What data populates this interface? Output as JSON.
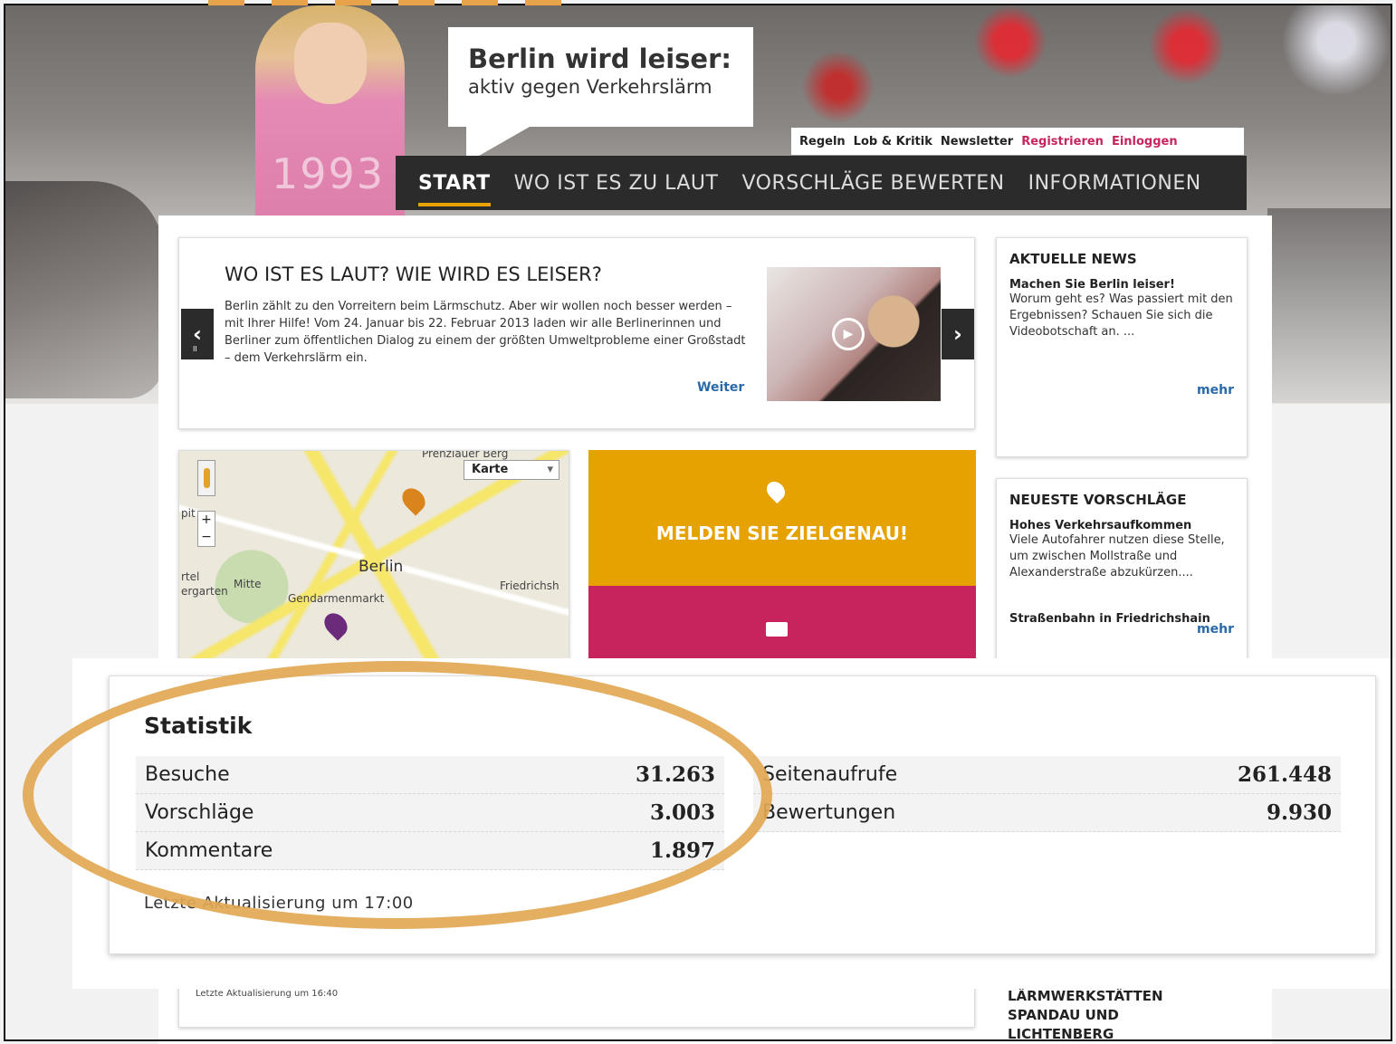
{
  "header": {
    "title": "Berlin wird leiser:",
    "subtitle": "aktiv gegen Verkehrslärm",
    "girl_shirt": "1993"
  },
  "utility_links": [
    "Regeln",
    "Lob & Kritik",
    "Newsletter",
    "Registrieren",
    "Einloggen"
  ],
  "nav": {
    "items": [
      "START",
      "WO IST ES ZU LAUT",
      "VORSCHLÄGE BEWERTEN",
      "INFORMATIONEN"
    ],
    "active": "START",
    "accent": "#e8a300"
  },
  "slider": {
    "title": "WO IST ES LAUT? WIE WIRD ES LEISER?",
    "text": "Berlin zählt zu den Vorreitern beim Lärmschutz. Aber wir wollen noch besser werden – mit Ihrer Hilfe! Vom 24. Januar bis 22. Februar 2013 laden wir alle Berlinerinnen und Berliner zum öffentlichen Dialog zu einem der größten Umweltprobleme einer Großstadt – dem Verkehrslärm ein.",
    "more": "Weiter",
    "prev_icon": "chevron-left-icon",
    "next_icon": "chevron-right-icon"
  },
  "news": {
    "heading": "AKTUELLE NEWS",
    "item_title": "Machen Sie Berlin leiser!",
    "item_text": "Worum geht es? Was passiert mit den Ergebnissen? Schauen Sie sich die Videobotschaft an. ...",
    "more": "mehr"
  },
  "proposals": {
    "heading": "NEUESTE VORSCHLÄGE",
    "item_title": "Hohes Verkehrsaufkommen",
    "item_text": "Viele Autofahrer nutzen diese Stelle, um zwischen Mollstraße und Alexanderstraße abzukürzen....",
    "more": "mehr",
    "next_title": "Straßenbahn in Friedrichshain"
  },
  "map": {
    "type_select": "Karte",
    "city": "Berlin",
    "labels": [
      "Prenzlauer Berg",
      "Mitte",
      "Gendarmenmarkt",
      "Friedrichsh",
      "ergarten",
      "rtel",
      "pit"
    ]
  },
  "tiles": {
    "report": "MELDEN SIE ZIELGENAU!",
    "colors": {
      "report": "#e6a200",
      "discuss": "#c7245e"
    }
  },
  "statistics": {
    "title": "Statistik",
    "left": [
      {
        "label": "Besuche",
        "value": "31.263"
      },
      {
        "label": "Vorschläge",
        "value": "3.003"
      },
      {
        "label": "Kommentare",
        "value": "1.897"
      }
    ],
    "right": [
      {
        "label": "Seitenaufrufe",
        "value": "261.448"
      },
      {
        "label": "Bewertungen",
        "value": "9.930"
      }
    ],
    "updated": "Letzte Aktualisierung um 17:00",
    "highlight_color": "#e2a852"
  },
  "bottom": {
    "updated": "Letzte Aktualisierung um 16:40",
    "side_heading": "LÄRMWERKSTÄTTEN SPANDAU UND LICHTENBERG"
  }
}
